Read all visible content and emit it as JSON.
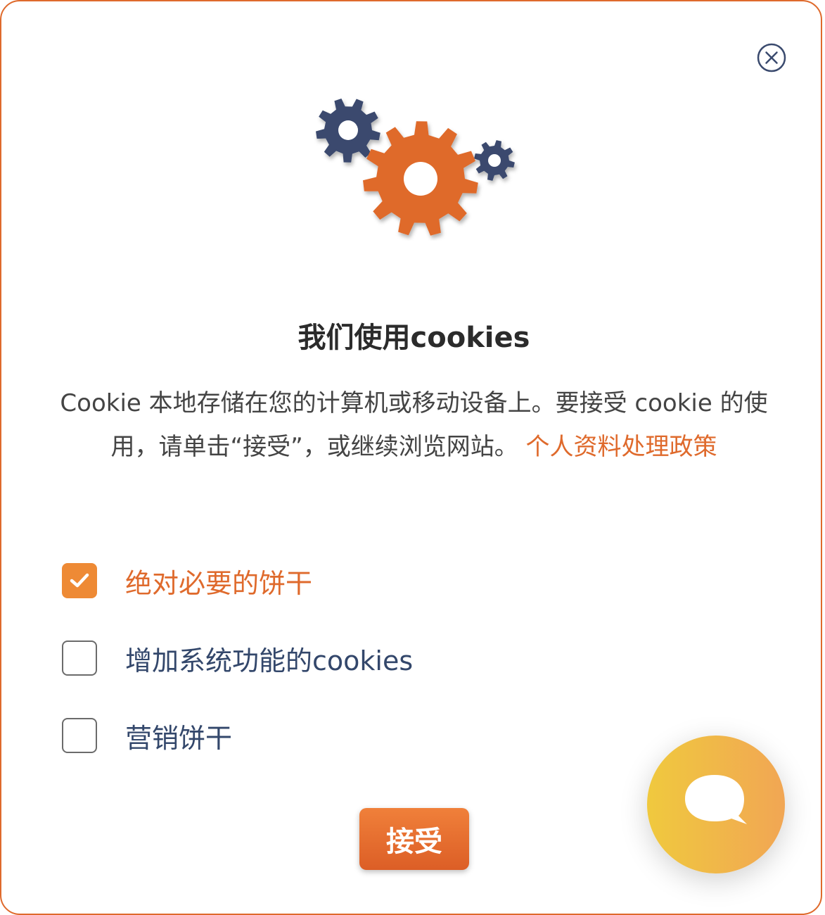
{
  "dialog": {
    "title": "我们使用cookies",
    "description": "Cookie 本地存储在您的计算机或移动设备上。要接受 cookie 的使用，请单击“接受”，或继续浏览网站。",
    "policy_link": "个人资料处理政策",
    "options": [
      {
        "label": "绝对必要的饼干",
        "checked": true
      },
      {
        "label": "增加系统功能的cookies",
        "checked": false
      },
      {
        "label": "营销饼干",
        "checked": false
      }
    ],
    "accept_label": "接受"
  },
  "icons": {
    "close": "close-circle-icon",
    "illustration": "gears-icon",
    "chat": "chat-bubble-icon",
    "check": "checkmark-icon"
  },
  "colors": {
    "accent": "#df6a2c",
    "checkbox_checked": "#ee8a35",
    "gear_dark": "#3a4a6e",
    "option_text": "#33476b",
    "chat_gradient_start": "#f0c93e",
    "chat_gradient_end": "#f1a654"
  }
}
